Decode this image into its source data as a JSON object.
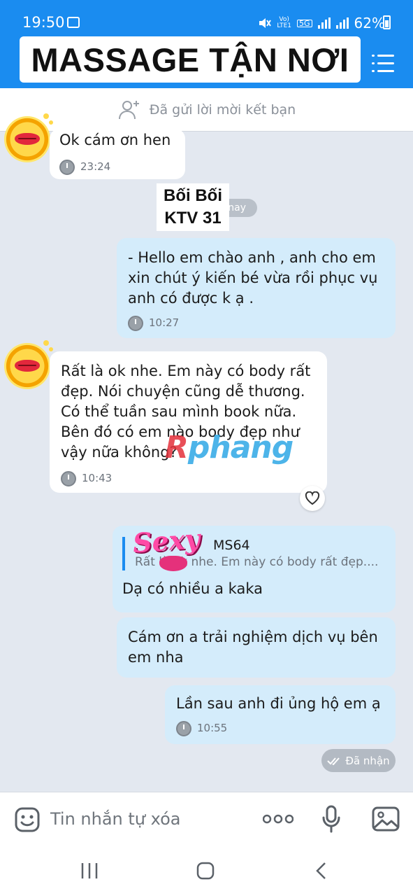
{
  "status_bar": {
    "time": "19:50",
    "network_top": "Vo)",
    "network_bottom": "LTE1",
    "network_type": "5G",
    "battery": "62%"
  },
  "header": {
    "title": "MASSAGE TẬN NƠI"
  },
  "friend_request": {
    "text": "Đã gửi lời mời kết bạn"
  },
  "messages": [
    {
      "direction": "in",
      "text": "Ok cám ơn hen",
      "time": "23:24"
    },
    {
      "direction": "out",
      "text": "- Hello em chào anh , anh cho em\nxin chút ý kiến bé vừa rồi phục vụ\nanh có được k ạ .",
      "time": "10:27"
    },
    {
      "direction": "in",
      "text": "Rất là ok nhe. Em này có body rất\nđẹp. Nói chuyện cũng dễ thương.\nCó thể tuần sau mình book nữa.\nBên đó có em nào body đẹp như\nvậy nữa không?",
      "time": "10:43"
    },
    {
      "direction": "out",
      "text": "Dạ có nhiều a kaka",
      "quote": {
        "author": "MS64",
        "text": "Rất là ok nhe. Em này có body rất đẹp...."
      }
    },
    {
      "direction": "out",
      "text": "Cám ơn a trải nghiệm dịch vụ bên\nem nha"
    },
    {
      "direction": "out",
      "text": "Lần sau anh đi ủng hộ em ạ",
      "time": "10:55"
    }
  ],
  "date_chip": "nay",
  "name_label": "Bối Bối\nKTV 31",
  "watermark": {
    "r": "R",
    "rest": "phang"
  },
  "sticker_text": "Sexy",
  "seen_status": "Đã nhận",
  "composer": {
    "placeholder": "Tin nhắn tự xóa"
  },
  "colors": {
    "brand_blue": "#1a8cf0",
    "outgoing_bubble": "#d4ecfb",
    "incoming_bubble": "#ffffff",
    "chat_background": "#e3e8f0"
  }
}
